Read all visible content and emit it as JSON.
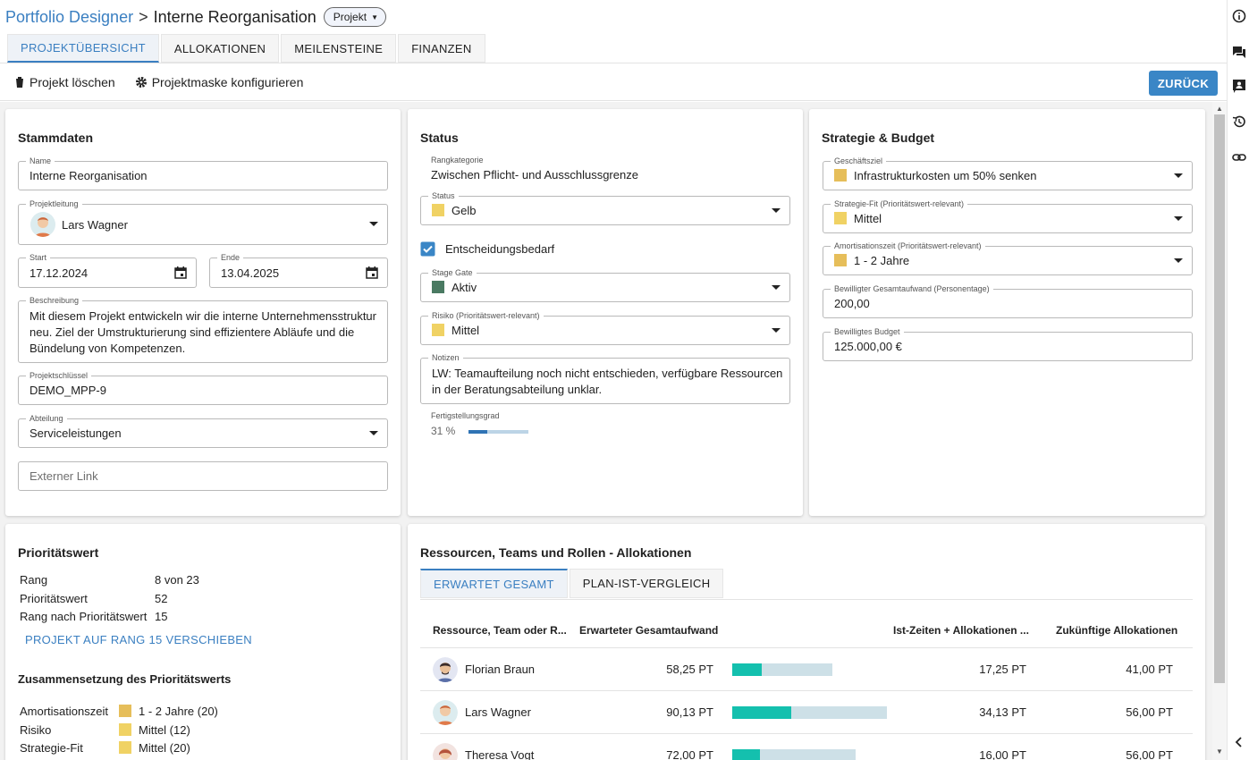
{
  "header": {
    "app": "Portfolio Designer",
    "separator": ">",
    "title": "Interne Reorganisation",
    "type_chip": "Projekt"
  },
  "tabs": [
    {
      "label": "PROJEKTÜBERSICHT",
      "active": true
    },
    {
      "label": "ALLOKATIONEN",
      "active": false
    },
    {
      "label": "MEILENSTEINE",
      "active": false
    },
    {
      "label": "FINANZEN",
      "active": false
    }
  ],
  "toolbar": {
    "delete_label": "Projekt löschen",
    "configure_label": "Projektmaske konfigurieren",
    "back_label": "ZURÜCK"
  },
  "stammdaten": {
    "title": "Stammdaten",
    "name_label": "Name",
    "name_value": "Interne Reorganisation",
    "lead_label": "Projektleitung",
    "lead_value": "Lars Wagner",
    "start_label": "Start",
    "start_value": "17.12.2024",
    "end_label": "Ende",
    "end_value": "13.04.2025",
    "desc_label": "Beschreibung",
    "desc_lines": [
      "Mit diesem Projekt entwickeln wir die interne Unternehmensstruktur",
      "neu. Ziel der Umstrukturierung sind effizientere Abläufe und die",
      "Bündelung von Kompetenzen."
    ],
    "key_label": "Projektschlüssel",
    "key_value": "DEMO_MPP-9",
    "dept_label": "Abteilung",
    "dept_value": "Serviceleistungen",
    "link_placeholder": "Externer Link"
  },
  "status": {
    "title": "Status",
    "rank_cat_label": "Rangkategorie",
    "rank_cat_value": "Zwischen Pflicht- und Ausschlussgrenze",
    "status_label": "Status",
    "status_value": "Gelb",
    "status_color": "#f0d264",
    "decision_label": "Entscheidungsbedarf",
    "decision_checked": true,
    "gate_label": "Stage Gate",
    "gate_value": "Aktiv",
    "gate_color": "#4a7a62",
    "risk_label": "Risiko (Prioritätswert-relevant)",
    "risk_value": "Mittel",
    "risk_color": "#f0d264",
    "notes_label": "Notizen",
    "notes_lines": [
      "LW: Teamaufteilung noch nicht entschieden, verfügbare Ressourcen",
      "in der Beratungsabteilung unklar."
    ],
    "progress_label": "Fertigstellungsgrad",
    "progress_text": "31 %",
    "progress_value": 0.31
  },
  "strategie": {
    "title": "Strategie & Budget",
    "goal_label": "Geschäftsziel",
    "goal_value": "Infrastrukturkosten um 50% senken",
    "goal_color": "#e6be5a",
    "fit_label": "Strategie-Fit (Prioritätswert-relevant)",
    "fit_value": "Mittel",
    "fit_color": "#f0d264",
    "payback_label": "Amortisationszeit (Prioritätswert-relevant)",
    "payback_value": "1 - 2 Jahre",
    "payback_color": "#e6be5a",
    "effort_label": "Bewilligter Gesamtaufwand (Personentage)",
    "effort_value": "200,00",
    "budget_label": "Bewilligtes Budget",
    "budget_value": "125.000,00 €"
  },
  "prio": {
    "title": "Prioritätswert",
    "rows": [
      {
        "k": "Rang",
        "v": "8 von 23"
      },
      {
        "k": "Prioritätswert",
        "v": "52"
      },
      {
        "k": "Rang nach Prioritätswert",
        "v": "15"
      }
    ],
    "move_link": "PROJEKT AUF RANG 15 VERSCHIEBEN",
    "comp_title": "Zusammensetzung des Prioritätswerts",
    "comp": [
      {
        "k": "Amortisationszeit",
        "v": "1 - 2 Jahre (20)",
        "color": "#e6be5a"
      },
      {
        "k": "Risiko",
        "v": "Mittel (12)",
        "color": "#f0d264"
      },
      {
        "k": "Strategie-Fit",
        "v": "Mittel (20)",
        "color": "#f0d264"
      }
    ]
  },
  "alloc": {
    "title": "Ressourcen, Teams und Rollen - Allokationen",
    "subtabs": [
      {
        "label": "ERWARTET GESAMT",
        "active": true
      },
      {
        "label": "PLAN-IST-VERGLEICH",
        "active": false
      }
    ],
    "headers": {
      "resource": "Ressource, Team oder R...",
      "expected": "Erwarteter Gesamtaufwand",
      "actual": "Ist-Zeiten + Allokationen ...",
      "future": "Zukünftige Allokationen"
    },
    "rows": [
      {
        "name": "Florian Braun",
        "expected": "58,25 PT",
        "expected_num": 58.25,
        "actual": "17,25 PT",
        "actual_num": 17.25,
        "future": "41,00 PT"
      },
      {
        "name": "Lars Wagner",
        "expected": "90,13 PT",
        "expected_num": 90.13,
        "actual": "34,13 PT",
        "actual_num": 34.13,
        "future": "56,00 PT"
      },
      {
        "name": "Theresa Vogt",
        "expected": "72,00 PT",
        "expected_num": 72.0,
        "actual": "16,00 PT",
        "actual_num": 16.0,
        "future": "56,00 PT"
      }
    ]
  },
  "rail_icons": [
    "info-icon",
    "chat-icon",
    "contact-card-icon",
    "history-icon",
    "link-icon",
    "collapse-left-icon"
  ]
}
